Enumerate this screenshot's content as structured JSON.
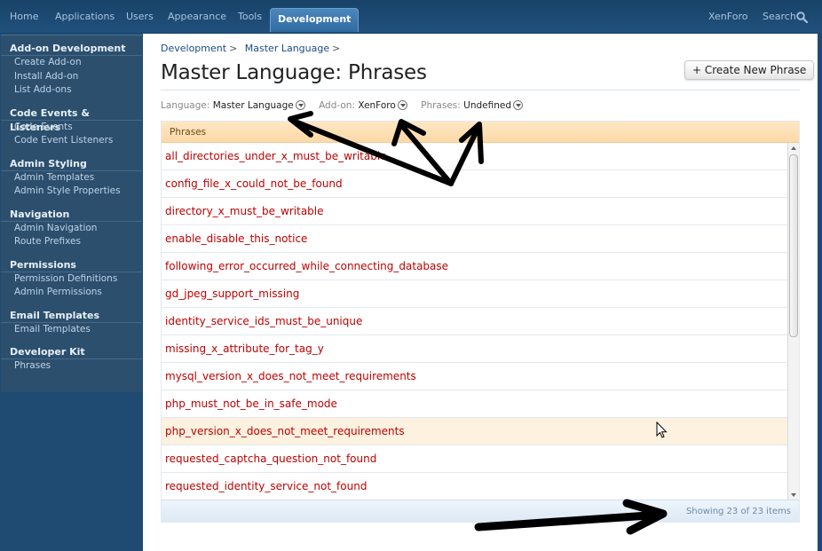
{
  "nav": {
    "tabs": [
      "Home",
      "Applications",
      "Users",
      "Appearance",
      "Tools"
    ],
    "active_tab": "Development",
    "right_links": [
      "XenForo",
      "Search"
    ]
  },
  "sidebar": {
    "groups": [
      {
        "title": "Add-on Development",
        "items": [
          "Create Add-on",
          "Install Add-on",
          "List Add-ons"
        ]
      },
      {
        "title": "Code Events & Listeners",
        "items": [
          "Code Events",
          "Code Event Listeners"
        ]
      },
      {
        "title": "Admin Styling",
        "items": [
          "Admin Templates",
          "Admin Style Properties"
        ]
      },
      {
        "title": "Navigation",
        "items": [
          "Admin Navigation",
          "Route Prefixes"
        ]
      },
      {
        "title": "Permissions",
        "items": [
          "Permission Definitions",
          "Admin Permissions"
        ]
      },
      {
        "title": "Email Templates",
        "items": [
          "Email Templates"
        ]
      },
      {
        "title": "Developer Kit",
        "items": [
          "Phrases"
        ]
      }
    ]
  },
  "breadcrumb": [
    "Development",
    "Master Language"
  ],
  "page_title": "Master Language: Phrases",
  "create_button": "+ Create New Phrase",
  "filters": {
    "language": {
      "label": "Language:",
      "value": "Master Language"
    },
    "addon": {
      "label": "Add-on:",
      "value": "XenForo"
    },
    "phrases": {
      "label": "Phrases:",
      "value": "Undefined"
    }
  },
  "list": {
    "header": "Phrases",
    "rows": [
      "all_directories_under_x_must_be_writable",
      "config_file_x_could_not_be_found",
      "directory_x_must_be_writable",
      "enable_disable_this_notice",
      "following_error_occurred_while_connecting_database",
      "gd_jpeg_support_missing",
      "identity_service_ids_must_be_unique",
      "missing_x_attribute_for_tag_y",
      "mysql_version_x_does_not_meet_requirements",
      "php_must_not_be_in_safe_mode",
      "php_version_x_does_not_meet_requirements",
      "requested_captcha_question_not_found",
      "requested_identity_service_not_found"
    ],
    "hover_row": 10,
    "footer": "Showing 23 of 23 items"
  }
}
